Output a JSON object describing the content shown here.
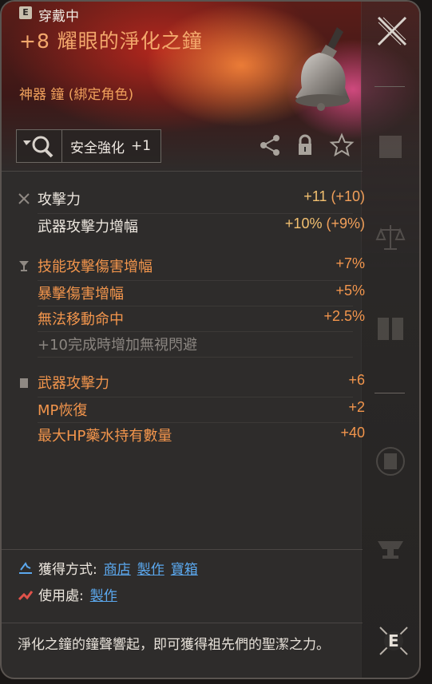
{
  "header": {
    "equip_badge": "E",
    "equip_status": "穿戴中",
    "item_name": "+8 耀眼的淨化之鐘",
    "item_type": "神器 鐘 (綁定角色)",
    "colors": {
      "name": "#f3a86c",
      "type": "#f0a15c",
      "bg_red": "#5b1d18",
      "bg_pink": "#ff5aa0"
    }
  },
  "toolbar": {
    "enhance_label": "安全強化",
    "enhance_value": "+1",
    "share_icon": "share-icon",
    "lock_icon": "lock-icon",
    "favorite_icon": "star-icon",
    "close_icon": "close-icon"
  },
  "stats": {
    "base": [
      {
        "label": "攻擊力",
        "value": "+11",
        "extra": "(+10)"
      },
      {
        "label": "武器攻擊力增幅",
        "value": "+10%",
        "extra": "(+9%)"
      }
    ],
    "bonus": [
      {
        "label": "技能攻擊傷害增幅",
        "value": "+7%"
      },
      {
        "label": "暴擊傷害增幅",
        "value": "+5%"
      },
      {
        "label": "無法移動命中",
        "value": "+2.5%"
      }
    ],
    "bonus_note": "+10完成時增加無視閃避",
    "extra": [
      {
        "label": "武器攻擊力",
        "value": "+6"
      },
      {
        "label": "MP恢復",
        "value": "+2"
      },
      {
        "label": "最大HP藥水持有數量",
        "value": "+40"
      }
    ]
  },
  "sources": {
    "obtain_label": "獲得方式:",
    "obtain_links": [
      "商店",
      "製作",
      "寶箱"
    ],
    "use_label": "使用處:",
    "use_links": [
      "製作"
    ]
  },
  "description": "淨化之鐘的鐘聲響起，即可獲得祖先們的聖潔之力。",
  "rail": {
    "icons": [
      "armor-icon",
      "scales-icon",
      "book-icon",
      "scroll-icon",
      "anvil-icon",
      "e-key-icon"
    ],
    "e_key_label": "E"
  }
}
